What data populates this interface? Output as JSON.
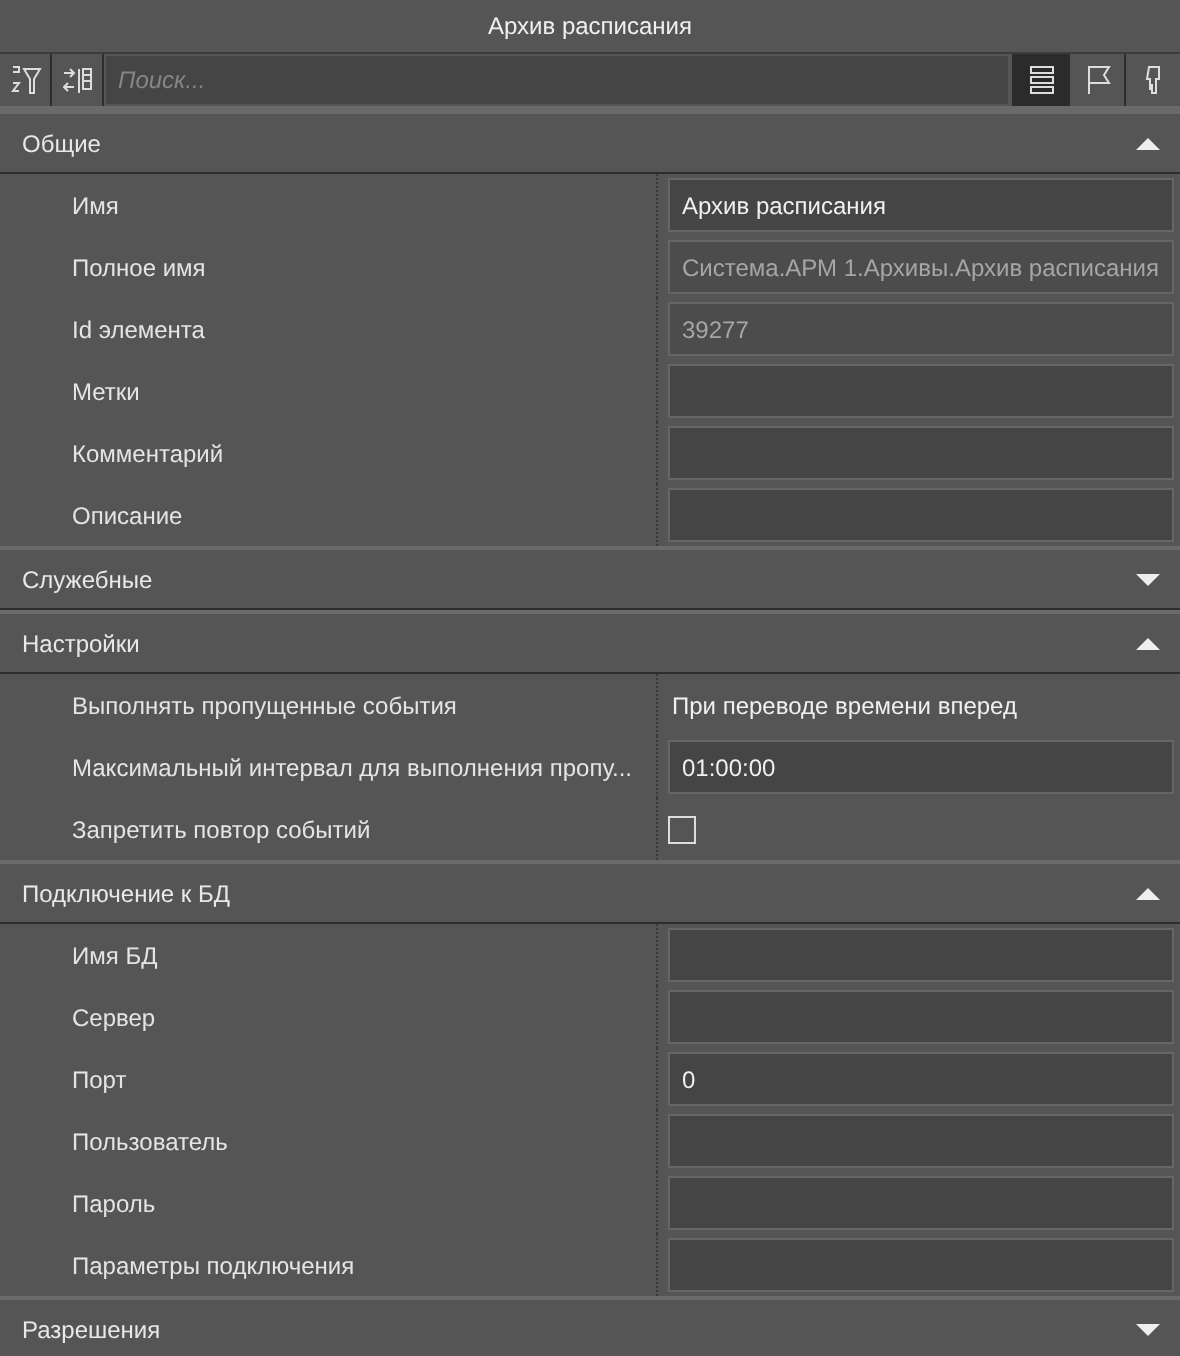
{
  "window": {
    "title": "Архив расписания"
  },
  "toolbar": {
    "search": {
      "placeholder": "Поиск..."
    },
    "view_buttons": [
      {
        "selected": true
      },
      {
        "selected": false
      },
      {
        "selected": false
      }
    ]
  },
  "sections": [
    {
      "title": "Общие",
      "expanded": true,
      "rows": [
        {
          "label": "Имя",
          "kind": "field",
          "value": "Архив расписания",
          "disabled": false
        },
        {
          "label": "Полное имя",
          "kind": "field",
          "value": "Система.АРМ 1.Архивы.Архив расписания",
          "disabled": true
        },
        {
          "label": "Id элемента",
          "kind": "field",
          "value": "39277",
          "disabled": true
        },
        {
          "label": "Метки",
          "kind": "field",
          "disabled": false
        },
        {
          "label": "Комментарий",
          "kind": "field",
          "disabled": false
        },
        {
          "label": "Описание",
          "kind": "field",
          "disabled": false
        }
      ]
    },
    {
      "title": "Служебные",
      "expanded": false
    },
    {
      "title": "Настройки",
      "expanded": true,
      "rows": [
        {
          "label": "Выполнять пропущенные события",
          "kind": "text",
          "value": "При переводе времени вперед"
        },
        {
          "label": "Максимальный интервал для выполнения пропу...",
          "kind": "field",
          "value": "01:00:00",
          "disabled": false
        },
        {
          "label": "Запретить повтор событий",
          "kind": "checkbox",
          "checked": false
        }
      ]
    },
    {
      "title": "Подключение к БД",
      "expanded": true,
      "rows": [
        {
          "label": "Имя БД",
          "kind": "field",
          "disabled": false
        },
        {
          "label": "Сервер",
          "kind": "field",
          "disabled": false
        },
        {
          "label": "Порт",
          "kind": "field",
          "value": "0",
          "disabled": false
        },
        {
          "label": "Пользователь",
          "kind": "field",
          "disabled": false
        },
        {
          "label": "Пароль",
          "kind": "field",
          "disabled": false
        },
        {
          "label": "Параметры подключения",
          "kind": "field",
          "disabled": false
        }
      ]
    },
    {
      "title": "Разрешения",
      "expanded": false
    }
  ]
}
